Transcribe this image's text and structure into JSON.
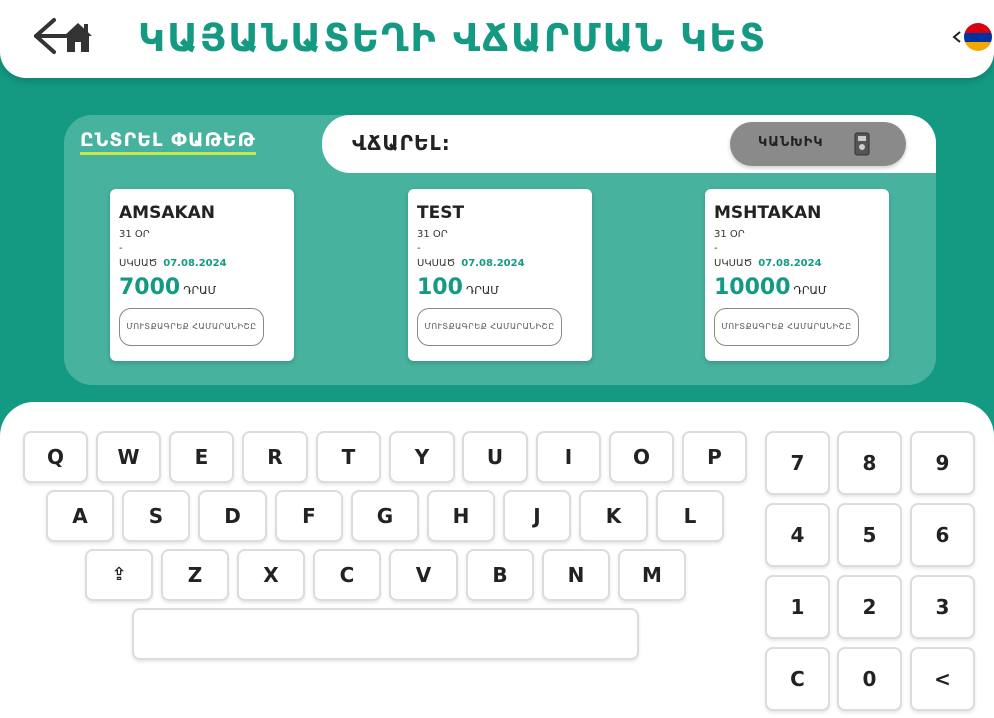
{
  "header": {
    "title": "ԿԱՅԱՆԱՏԵՂԻ ՎՃԱՐՄԱՆ ԿԵՏ",
    "back_icon": "arrow-left-icon",
    "home_icon": "home-icon",
    "language_icon": "armenian-flag-icon"
  },
  "panel": {
    "select_package_label": "ԸՆՏՐԵԼ ՓԱԹԵԹ",
    "pay_label": "ՎՃԱՐԵԼ:",
    "cash_button_label": "ԿԱՆԽԻԿ",
    "cash_icon": "cash-terminal-icon"
  },
  "packages": [
    {
      "name": "AMSAKAN",
      "duration": "31 ՕՐ",
      "dash": "-",
      "start_label": "ՍԿՍԱԾ",
      "start_date": "07.08.2024",
      "amount": "7000",
      "currency": "ԴՐԱՄ",
      "details_label": "ՄՈՒՏՔԱԳՐԵՔ ՀԱՄԱՐԱՆԻՇԸ"
    },
    {
      "name": "TEST",
      "duration": "31 ՕՐ",
      "dash": "-",
      "start_label": "ՍԿՍԱԾ",
      "start_date": "07.08.2024",
      "amount": "100",
      "currency": "ԴՐԱՄ",
      "details_label": "ՄՈՒՏՔԱԳՐԵՔ ՀԱՄԱՐԱՆԻՇԸ"
    },
    {
      "name": "MSHTAKAN",
      "duration": "31 ՕՐ",
      "dash": "-",
      "start_label": "ՍԿՍԱԾ",
      "start_date": "07.08.2024",
      "amount": "10000",
      "currency": "ԴՐԱՄ",
      "details_label": "ՄՈՒՏՔԱԳՐԵՔ ՀԱՄԱՐԱՆԻՇԸ"
    }
  ],
  "keyboard": {
    "row1": [
      "Q",
      "W",
      "E",
      "R",
      "T",
      "Y",
      "U",
      "I",
      "O",
      "P"
    ],
    "row2": [
      "A",
      "S",
      "D",
      "F",
      "G",
      "H",
      "J",
      "K",
      "L"
    ],
    "row3": [
      "⇪",
      "Z",
      "X",
      "C",
      "V",
      "B",
      "N",
      "M"
    ],
    "space_label": "",
    "numpad": [
      "7",
      "8",
      "9",
      "4",
      "5",
      "6",
      "1",
      "2",
      "3",
      "C",
      "0",
      "<"
    ]
  },
  "colors": {
    "primary": "#149a83",
    "panel": "#47b29e",
    "underline": "#c5e84a",
    "cash_button": "#8a8a8a"
  }
}
